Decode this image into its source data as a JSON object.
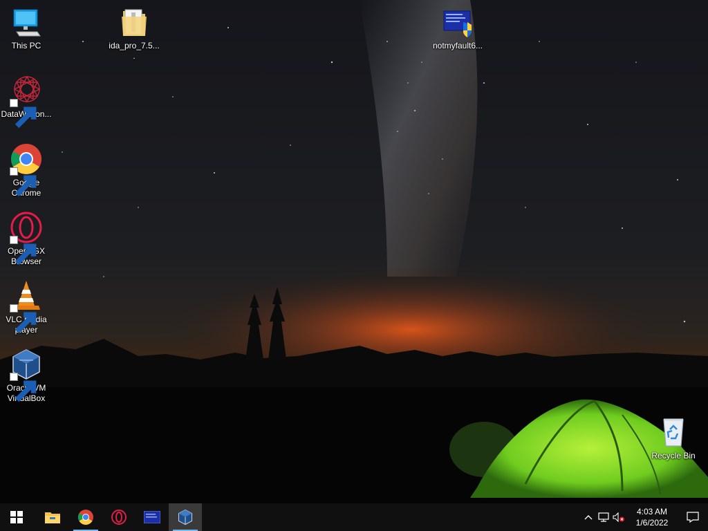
{
  "desktop": {
    "icons": [
      {
        "id": "this-pc",
        "label": "This PC",
        "shortcut": false
      },
      {
        "id": "ida",
        "label": "ida_pro_7.5....",
        "shortcut": false
      },
      {
        "id": "notmyfault",
        "label": "notmyfault6...",
        "shortcut": false
      },
      {
        "id": "datawagon",
        "label": "DataWagon...",
        "shortcut": true
      },
      {
        "id": "chrome",
        "label": "Google Chrome",
        "shortcut": true
      },
      {
        "id": "opera",
        "label": "Opera GX Browser",
        "shortcut": true
      },
      {
        "id": "vlc",
        "label": "VLC media player",
        "shortcut": true
      },
      {
        "id": "virtualbox",
        "label": "Oracle VM VirtualBox",
        "shortcut": true
      },
      {
        "id": "recycle",
        "label": "Recycle Bin",
        "shortcut": false
      }
    ]
  },
  "taskbar": {
    "pinned": [
      "start",
      "file-explorer",
      "chrome",
      "opera",
      "notmyfault",
      "virtualbox"
    ],
    "active": "virtualbox",
    "clock": {
      "time": "4:03 AM",
      "date": "1/6/2022"
    }
  },
  "colors": {
    "taskbar_bg": "#101010",
    "accent": "#76b9ed",
    "tent": "#7ad12a"
  }
}
